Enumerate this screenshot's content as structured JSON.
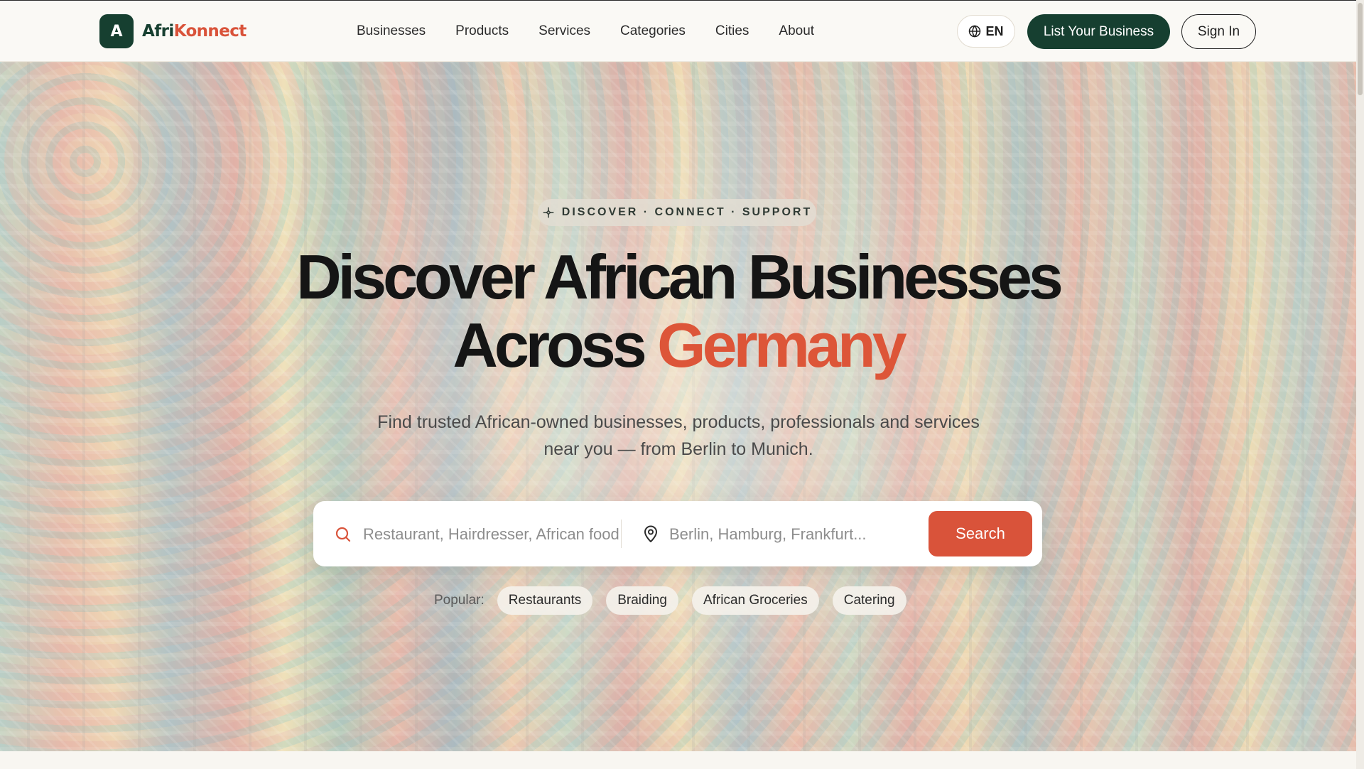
{
  "brand": {
    "logo_letter": "A",
    "name_part1": "Afri",
    "name_part2": "Konnect"
  },
  "nav": {
    "items": [
      {
        "label": "Businesses"
      },
      {
        "label": "Products"
      },
      {
        "label": "Services"
      },
      {
        "label": "Categories"
      },
      {
        "label": "Cities"
      },
      {
        "label": "About"
      }
    ]
  },
  "header": {
    "language": "EN",
    "language_icon": "globe-icon",
    "list_business_label": "List Your Business",
    "sign_in_label": "Sign In"
  },
  "hero": {
    "tagline": "DISCOVER · CONNECT · SUPPORT",
    "tagline_icon": "sparkle-icon",
    "headline_line1": "Discover African Businesses",
    "headline_line2_plain": "Across",
    "headline_line2_accent": "Germany",
    "subtitle_line1": "Find trusted African-owned businesses, products, professionals and services",
    "subtitle_line2": "near you — from Berlin to Munich."
  },
  "search": {
    "query_icon": "search-icon",
    "query_placeholder": "Restaurant, Hairdresser, African food...",
    "location_icon": "map-pin-icon",
    "location_placeholder": "Berlin, Hamburg, Frankfurt...",
    "button_label": "Search"
  },
  "popular": {
    "label": "Popular:",
    "chips": [
      {
        "label": "Restaurants"
      },
      {
        "label": "Braiding"
      },
      {
        "label": "African Groceries"
      },
      {
        "label": "Catering"
      }
    ]
  },
  "colors": {
    "brand_green": "#163f30",
    "accent_coral": "#d9533a",
    "headline": "#151515",
    "background": "#f7f5f0"
  }
}
